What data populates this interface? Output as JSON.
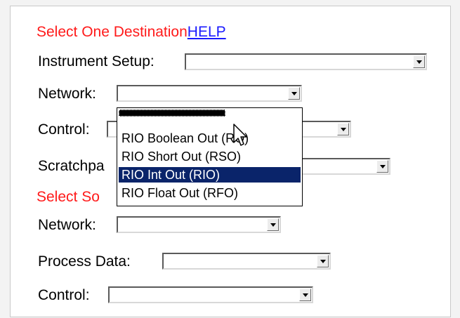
{
  "destination": {
    "heading": "Select One Destination",
    "help_link": "HELP",
    "instrument_setup_label": "Instrument Setup:",
    "network_label": "Network:",
    "control_label": "Control:",
    "scratchpad_label": "Scratchpa",
    "instrument_setup_value": "",
    "network_value": "",
    "control_value": "",
    "scratchpad_value": ""
  },
  "network_dropdown": {
    "options": [
      "",
      "RIO Boolean Out (RO)",
      "RIO Short Out (RSO)",
      "RIO Int Out (RIO)",
      "RIO Float Out (RFO)"
    ],
    "selected_index": 3
  },
  "source": {
    "heading": "Select So",
    "network_label": "Network:",
    "process_data_label": "Process Data:",
    "control_label": "Control:",
    "network_value": "",
    "process_data_value": "",
    "control_value": ""
  },
  "icons": {
    "dropdown_arrow": "chevron-down-icon",
    "cursor": "mouse-pointer-icon"
  },
  "colors": {
    "heading_red": "#ff1a1a",
    "link_blue": "#1a1aff",
    "selection_blue": "#0a246a"
  }
}
